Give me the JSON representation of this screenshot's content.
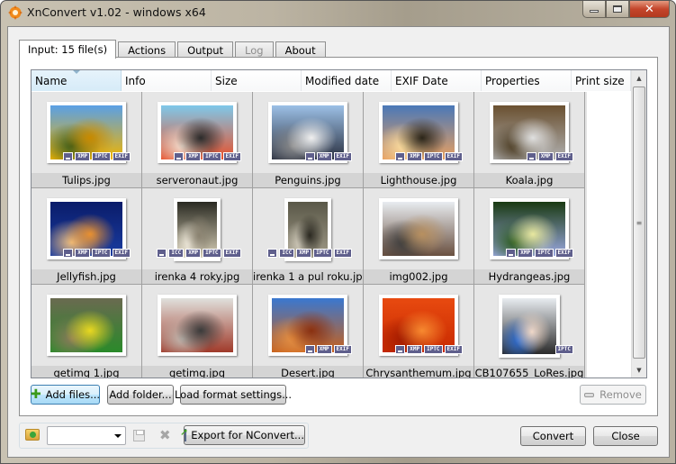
{
  "window": {
    "title": "XnConvert v1.02 - windows x64",
    "caption_buttons": {
      "minimize": "—",
      "maximize": "▢",
      "close": "✕"
    }
  },
  "tabs": [
    {
      "label": "Input: 15 file(s)",
      "state": "active"
    },
    {
      "label": "Actions",
      "state": "normal"
    },
    {
      "label": "Output",
      "state": "normal"
    },
    {
      "label": "Log",
      "state": "disabled"
    },
    {
      "label": "About",
      "state": "normal"
    }
  ],
  "list": {
    "columns": [
      "Name",
      "Info",
      "Size",
      "Modified date",
      "EXIF Date",
      "Properties",
      "Print size"
    ],
    "sorted_column": "Name",
    "files": [
      {
        "name": "Tulips.jpg",
        "badges": [
          "blank",
          "XMP",
          "IPTC",
          "EXIF"
        ],
        "colors": [
          "#5aa0e6",
          "#f0b400",
          "#c88a00",
          "#3a5a18"
        ],
        "orientation": "landscape"
      },
      {
        "name": "serveronaut.jpg",
        "badges": [
          "blank",
          "XMP",
          "IPTC",
          "EXIF"
        ],
        "colors": [
          "#7ec8ea",
          "#e8502a",
          "#2a2a2a",
          "#f3e0d0"
        ],
        "orientation": "landscape"
      },
      {
        "name": "Penguins.jpg",
        "badges": [
          "blank",
          "XMP",
          "EXIF"
        ],
        "colors": [
          "#9cc0e6",
          "#2a3040",
          "#f0f0f0",
          "#8a8a8a"
        ],
        "orientation": "landscape"
      },
      {
        "name": "Lighthouse.jpg",
        "badges": [
          "blank",
          "XMP",
          "IPTC",
          "EXIF"
        ],
        "colors": [
          "#4a78b8",
          "#e9a060",
          "#2a2418",
          "#ffe0a0"
        ],
        "orientation": "landscape"
      },
      {
        "name": "Koala.jpg",
        "badges": [
          "blank",
          "XMP",
          "EXIF"
        ],
        "colors": [
          "#6a5030",
          "#b0b0b0",
          "#e0e0e0",
          "#4a3a20"
        ],
        "orientation": "landscape"
      },
      {
        "name": "Jellyfish.jpg",
        "badges": [
          "blank",
          "XMP",
          "IPTC",
          "EXIF"
        ],
        "colors": [
          "#0a1c6a",
          "#1a3ca0",
          "#e89030",
          "#f0c080"
        ],
        "orientation": "landscape"
      },
      {
        "name": "irenka 4 roky.jpg",
        "badges": [
          "blank",
          "ICC",
          "XMP",
          "IPTC",
          "EXIF"
        ],
        "colors": [
          "#2a2a22",
          "#d8d0b8",
          "#8a8270",
          "#f0eadc"
        ],
        "orientation": "portrait"
      },
      {
        "name": "irenka 1 a pul roku.jpg",
        "badges": [
          "blank",
          "ICC",
          "XMP",
          "IPTC",
          "EXIF"
        ],
        "colors": [
          "#5a5848",
          "#a09a88",
          "#2a2820",
          "#d0caba"
        ],
        "orientation": "portrait"
      },
      {
        "name": "img002.jpg",
        "badges": [],
        "colors": [
          "#e8ecf0",
          "#6a5040",
          "#b89060",
          "#3a3a3a"
        ],
        "orientation": "landscape"
      },
      {
        "name": "Hydrangeas.jpg",
        "badges": [
          "blank",
          "XMP",
          "IPTC",
          "EXIF"
        ],
        "colors": [
          "#1a3a12",
          "#9aa8e0",
          "#e8e8a0",
          "#2a5a1a"
        ],
        "orientation": "landscape"
      },
      {
        "name": "getimg 1.jpg",
        "badges": [],
        "colors": [
          "#6a6a50",
          "#2a8a2a",
          "#e8d820",
          "#8a7a5a"
        ],
        "orientation": "landscape"
      },
      {
        "name": "getimg.jpg",
        "badges": [],
        "colors": [
          "#e0e0dc",
          "#a03a2a",
          "#3a3a3a",
          "#c0b8b0"
        ],
        "orientation": "landscape"
      },
      {
        "name": "Desert.jpg",
        "badges": [
          "blank",
          "XMP",
          "EXIF"
        ],
        "colors": [
          "#3a78d0",
          "#c8601a",
          "#8a3010",
          "#e89040"
        ],
        "orientation": "landscape"
      },
      {
        "name": "Chrysanthemum.jpg",
        "badges": [
          "blank",
          "XMP",
          "IPTC",
          "EXIF"
        ],
        "colors": [
          "#e84a10",
          "#c82a00",
          "#f88a30",
          "#a01a00"
        ],
        "orientation": "landscape"
      },
      {
        "name": "CB107655_LoRes.jpg",
        "badges": [
          "IPTC"
        ],
        "colors": [
          "#e8ecf0",
          "#2a2a2a",
          "#f0d8c8",
          "#2a6ad0"
        ],
        "orientation": "portrait-square"
      }
    ]
  },
  "buttons": {
    "add_files": "Add files...",
    "add_folder": "Add folder...",
    "load_format_settings": "Load format settings...",
    "remove": "Remove",
    "export_nconvert": "Export for NConvert...",
    "convert": "Convert",
    "close": "Close"
  },
  "preset_combo": {
    "value": ""
  },
  "icons": {
    "app": "xnconvert-logo-icon",
    "add": "plus-icon",
    "remove": "minus-icon",
    "load_preset": "folder-open-icon",
    "save_preset": "floppy-disk-icon",
    "delete_preset": "delete-x-icon",
    "export": "export-arrow-icon"
  }
}
